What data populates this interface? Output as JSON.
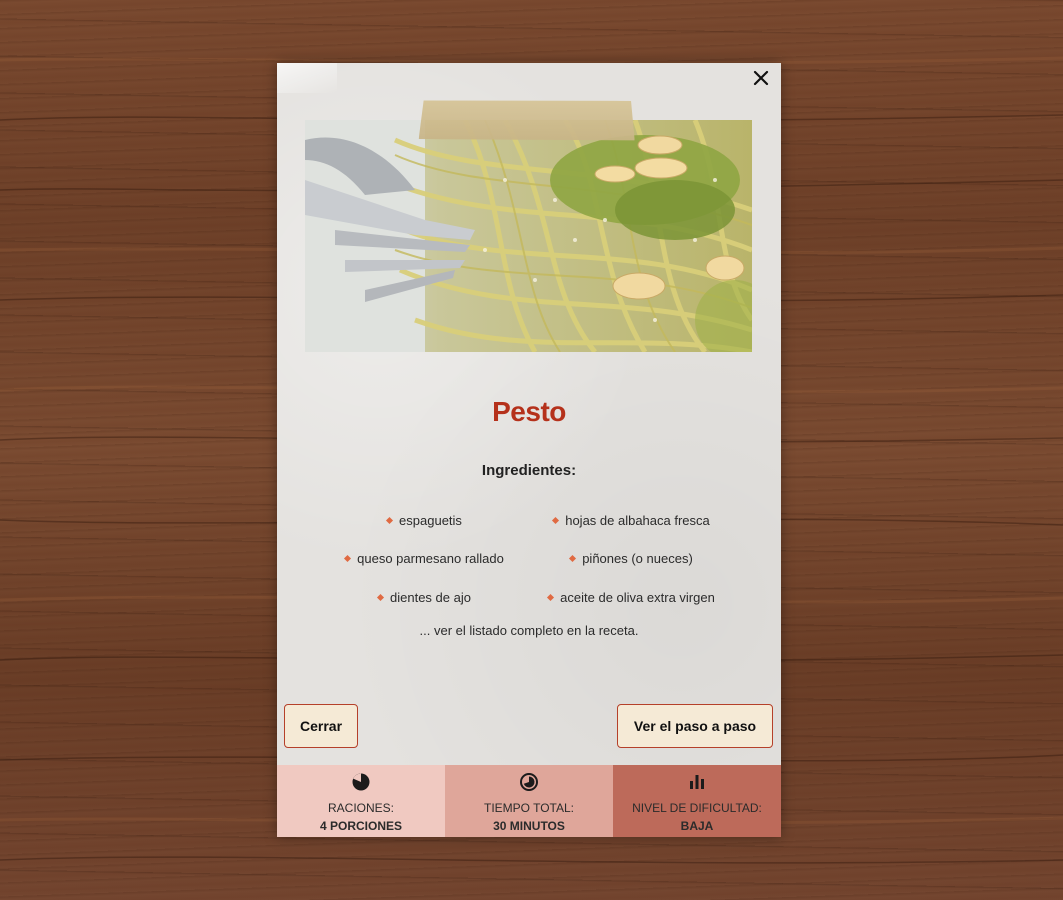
{
  "recipe": {
    "title": "Pesto",
    "ingredients_heading": "Ingredientes:",
    "ingredients": [
      "espaguetis",
      "hojas de albahaca fresca",
      "queso parmesano rallado",
      "piñones (o nueces)",
      "dientes de ajo",
      "aceite de oliva extra virgen"
    ],
    "more_text": "... ver el listado completo en la receta."
  },
  "buttons": {
    "close_label": "Cerrar",
    "steps_label": "Ver el paso a paso"
  },
  "stats": [
    {
      "icon": "pie-chart-icon",
      "label": "RACIONES:",
      "value": "4 PORCIONES"
    },
    {
      "icon": "timer-icon",
      "label": "TIEMPO TOTAL:",
      "value": "30 MINUTOS"
    },
    {
      "icon": "bar-chart-icon",
      "label": "NIVEL DE DIFICULTAD:",
      "value": "BAJA"
    }
  ],
  "icons": {
    "close": "close-icon",
    "photo": "pesto-pasta-photo",
    "tape": "tape-decoration"
  },
  "colors": {
    "title": "#b5311b",
    "bullet": "#e06a42",
    "button_border": "#b5402a",
    "button_bg": "#f5ead6",
    "stat_1": "#f0c9c1",
    "stat_2": "#dfa69a",
    "stat_3": "#bd6a5a"
  }
}
